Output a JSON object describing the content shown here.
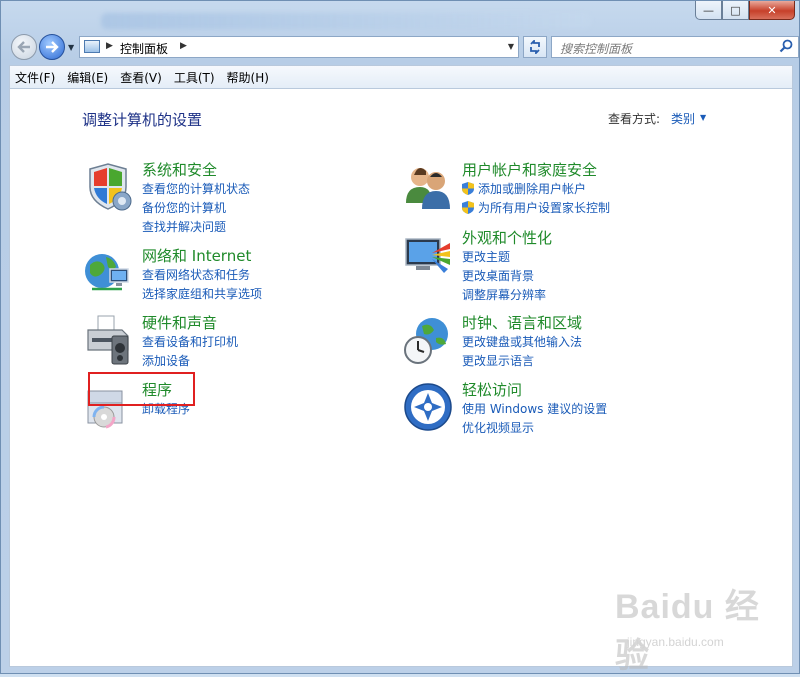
{
  "window": {
    "caption_buttons": [
      "—",
      "□",
      "✕"
    ]
  },
  "address_bar": {
    "path": "控制面板",
    "search_placeholder": "搜索控制面板"
  },
  "menu": [
    "文件(F)",
    "编辑(E)",
    "查看(V)",
    "工具(T)",
    "帮助(H)"
  ],
  "main": {
    "heading": "调整计算机的设置",
    "view_label": "查看方式:",
    "view_value": "类别"
  },
  "categories": [
    {
      "title": "系统和安全",
      "icon": "shield-pc-icon",
      "links": [
        "查看您的计算机状态",
        "备份您的计算机",
        "查找并解决问题"
      ]
    },
    {
      "title": "网络和 Internet",
      "icon": "globe-network-icon",
      "links": [
        "查看网络状态和任务",
        "选择家庭组和共享选项"
      ]
    },
    {
      "title": "硬件和声音",
      "icon": "printer-speaker-icon",
      "links": [
        "查看设备和打印机",
        "添加设备"
      ]
    },
    {
      "title": "程序",
      "icon": "programs-icon",
      "links": [
        "卸载程序"
      ]
    },
    {
      "title": "用户帐户和家庭安全",
      "icon": "users-icon",
      "links": [
        "添加或删除用户帐户",
        "为所有用户设置家长控制"
      ]
    },
    {
      "title": "外观和个性化",
      "icon": "monitor-palette-icon",
      "links": [
        "更改主题",
        "更改桌面背景",
        "调整屏幕分辨率"
      ]
    },
    {
      "title": "时钟、语言和区域",
      "icon": "clock-globe-icon",
      "links": [
        "更改键盘或其他输入法",
        "更改显示语言"
      ]
    },
    {
      "title": "轻松访问",
      "icon": "ease-of-access-icon",
      "links": [
        "使用 Windows 建议的设置",
        "优化视频显示"
      ]
    }
  ],
  "watermark": {
    "main": "Baidu 经验",
    "sub": "jingyan.baidu.com"
  },
  "colors": {
    "link": "#1a5bb8",
    "category_title": "#1f8a2a",
    "heading": "#1e3287",
    "highlight": "#e02020"
  }
}
